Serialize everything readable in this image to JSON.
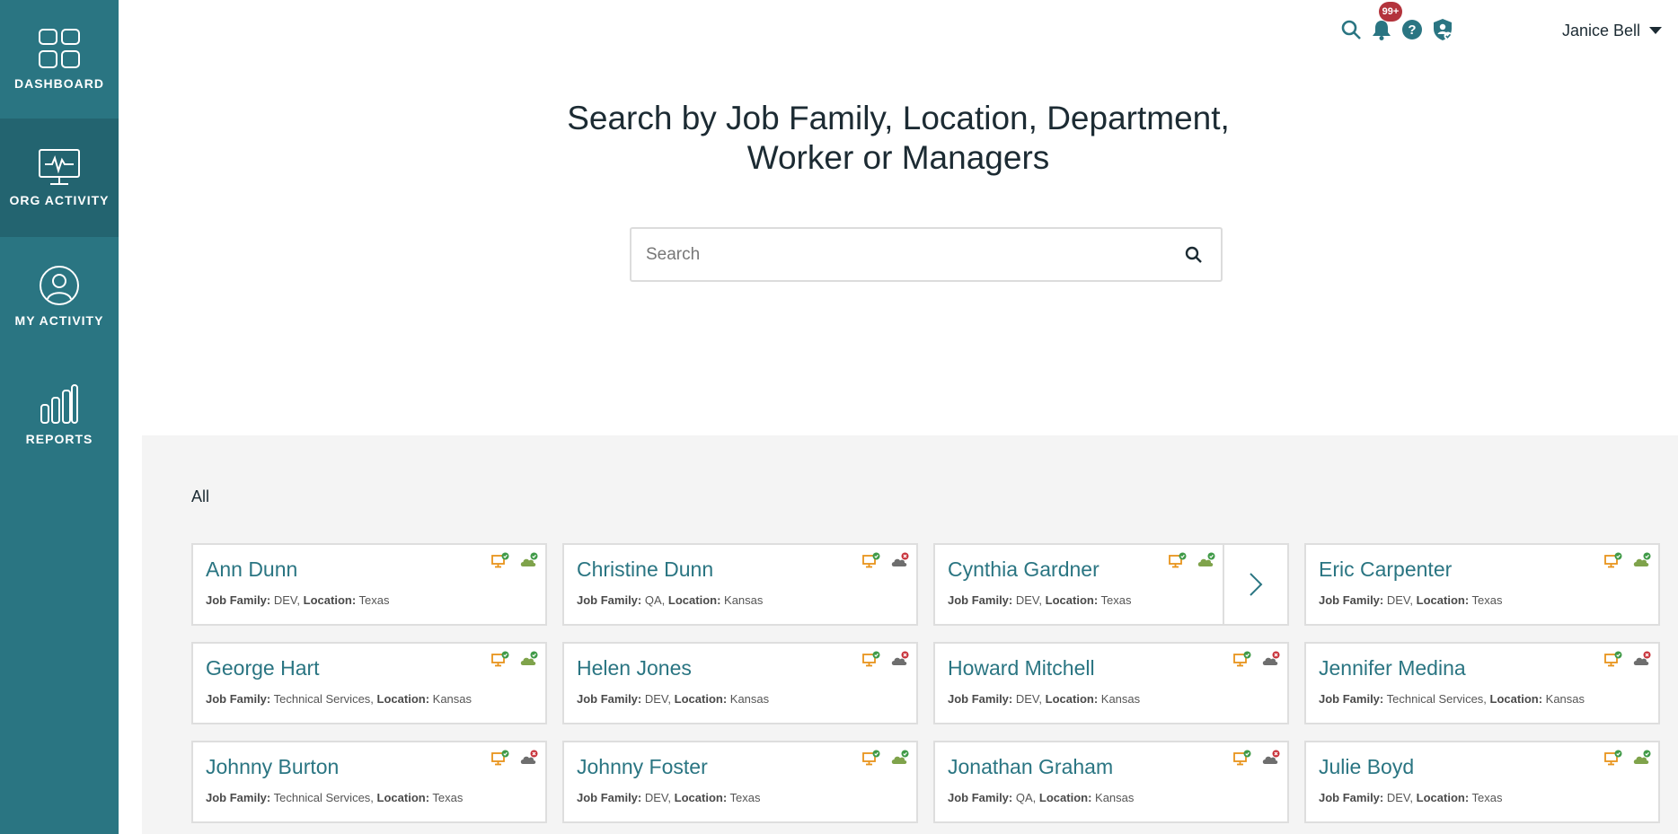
{
  "sidebar": {
    "items": [
      {
        "label": "DASHBOARD",
        "icon": "dashboard-grid-icon",
        "active": false
      },
      {
        "label": "ORG ACTIVITY",
        "icon": "monitor-activity-icon",
        "active": true
      },
      {
        "label": "MY ACTIVITY",
        "icon": "user-circle-icon",
        "active": false
      },
      {
        "label": "REPORTS",
        "icon": "bar-chart-icon",
        "active": false
      }
    ]
  },
  "topbar": {
    "notification_count": "99+",
    "user_name": "Janice Bell",
    "icons": [
      "search-icon",
      "bell-icon",
      "help-icon",
      "shield-user-icon"
    ]
  },
  "main": {
    "heading_line1": "Search by Job Family, Location, Department,",
    "heading_line2": "Worker or Managers",
    "search_placeholder": "Search",
    "filter_label": "All"
  },
  "labels": {
    "job_family": "Job Family:",
    "location": "Location:"
  },
  "colors": {
    "sidebar": "#2a7582",
    "sidebar_active": "#236470",
    "accent": "#2a7582",
    "badge": "#b3333c",
    "monitor_orange": "#e8941c",
    "cloud_green": "#7fa34b",
    "cloud_gray": "#6e6e6e",
    "status_ok": "#3f9a47",
    "status_error": "#c8323a"
  },
  "workers": [
    {
      "name": "Ann Dunn",
      "job_family": "DEV",
      "location": "Texas",
      "monitor_ok": true,
      "cloud_ok": true
    },
    {
      "name": "Christine Dunn",
      "job_family": "QA",
      "location": "Kansas",
      "monitor_ok": true,
      "cloud_ok": false
    },
    {
      "name": "Cynthia Gardner",
      "job_family": "DEV",
      "location": "Texas",
      "monitor_ok": true,
      "cloud_ok": true,
      "has_arrow": true
    },
    {
      "name": "Eric Carpenter",
      "job_family": "DEV",
      "location": "Texas",
      "monitor_ok": true,
      "cloud_ok": true
    },
    {
      "name": "George Hart",
      "job_family": "Technical Services",
      "location": "Kansas",
      "monitor_ok": true,
      "cloud_ok": true
    },
    {
      "name": "Helen Jones",
      "job_family": "DEV",
      "location": "Kansas",
      "monitor_ok": true,
      "cloud_ok": false
    },
    {
      "name": "Howard Mitchell",
      "job_family": "DEV",
      "location": "Kansas",
      "monitor_ok": true,
      "cloud_ok": false
    },
    {
      "name": "Jennifer Medina",
      "job_family": "Technical Services",
      "location": "Kansas",
      "monitor_ok": true,
      "cloud_ok": false
    },
    {
      "name": "Johnny Burton",
      "job_family": "Technical Services",
      "location": "Texas",
      "monitor_ok": true,
      "cloud_ok": false
    },
    {
      "name": "Johnny Foster",
      "job_family": "DEV",
      "location": "Texas",
      "monitor_ok": true,
      "cloud_ok": true
    },
    {
      "name": "Jonathan Graham",
      "job_family": "QA",
      "location": "Kansas",
      "monitor_ok": true,
      "cloud_ok": false
    },
    {
      "name": "Julie Boyd",
      "job_family": "DEV",
      "location": "Texas",
      "monitor_ok": true,
      "cloud_ok": true
    }
  ]
}
